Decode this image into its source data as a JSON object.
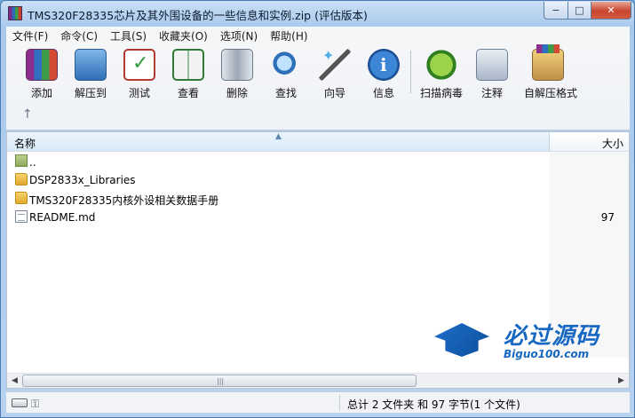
{
  "window": {
    "title": "TMS320F28335芯片及其外围设备的一些信息和实例.zip (评估版本)",
    "controls": {
      "minimize": "−",
      "maximize": "□",
      "close": "✕"
    }
  },
  "menu": [
    "文件(F)",
    "命令(C)",
    "工具(S)",
    "收藏夹(O)",
    "选项(N)",
    "帮助(H)"
  ],
  "toolbar": {
    "buttons": [
      {
        "label": "添加",
        "icon": "add-archive-icon"
      },
      {
        "label": "解压到",
        "icon": "extract-folder-icon"
      },
      {
        "label": "测试",
        "icon": "test-clipboard-icon"
      },
      {
        "label": "查看",
        "icon": "view-book-icon"
      },
      {
        "label": "删除",
        "icon": "trash-bin-icon"
      },
      {
        "label": "查找",
        "icon": "magnifier-icon"
      },
      {
        "label": "向导",
        "icon": "magic-wand-icon"
      },
      {
        "label": "信息",
        "icon": "info-icon"
      },
      {
        "label": "扫描病毒",
        "icon": "virus-scan-icon"
      },
      {
        "label": "注释",
        "icon": "comment-icon"
      },
      {
        "label": "自解压格式",
        "icon": "sfx-box-icon"
      }
    ],
    "up_arrow": "↑"
  },
  "list": {
    "columns": {
      "name": "名称",
      "size": "大小"
    },
    "rows": [
      {
        "name": "..",
        "size": "",
        "type": "parent-folder"
      },
      {
        "name": "DSP2833x_Libraries",
        "size": "",
        "type": "folder"
      },
      {
        "name": "TMS320F28335内核外设相关数据手册",
        "size": "",
        "type": "folder"
      },
      {
        "name": "README.md",
        "size": "97",
        "type": "file"
      }
    ]
  },
  "watermark": {
    "text": "必过源码",
    "url": "Biguo100.com"
  },
  "status": {
    "summary": "总计 2 文件夹 和 97 字节(1 个文件)"
  },
  "colors": {
    "accent": "#1768c2",
    "folder": "#e6b43a"
  }
}
